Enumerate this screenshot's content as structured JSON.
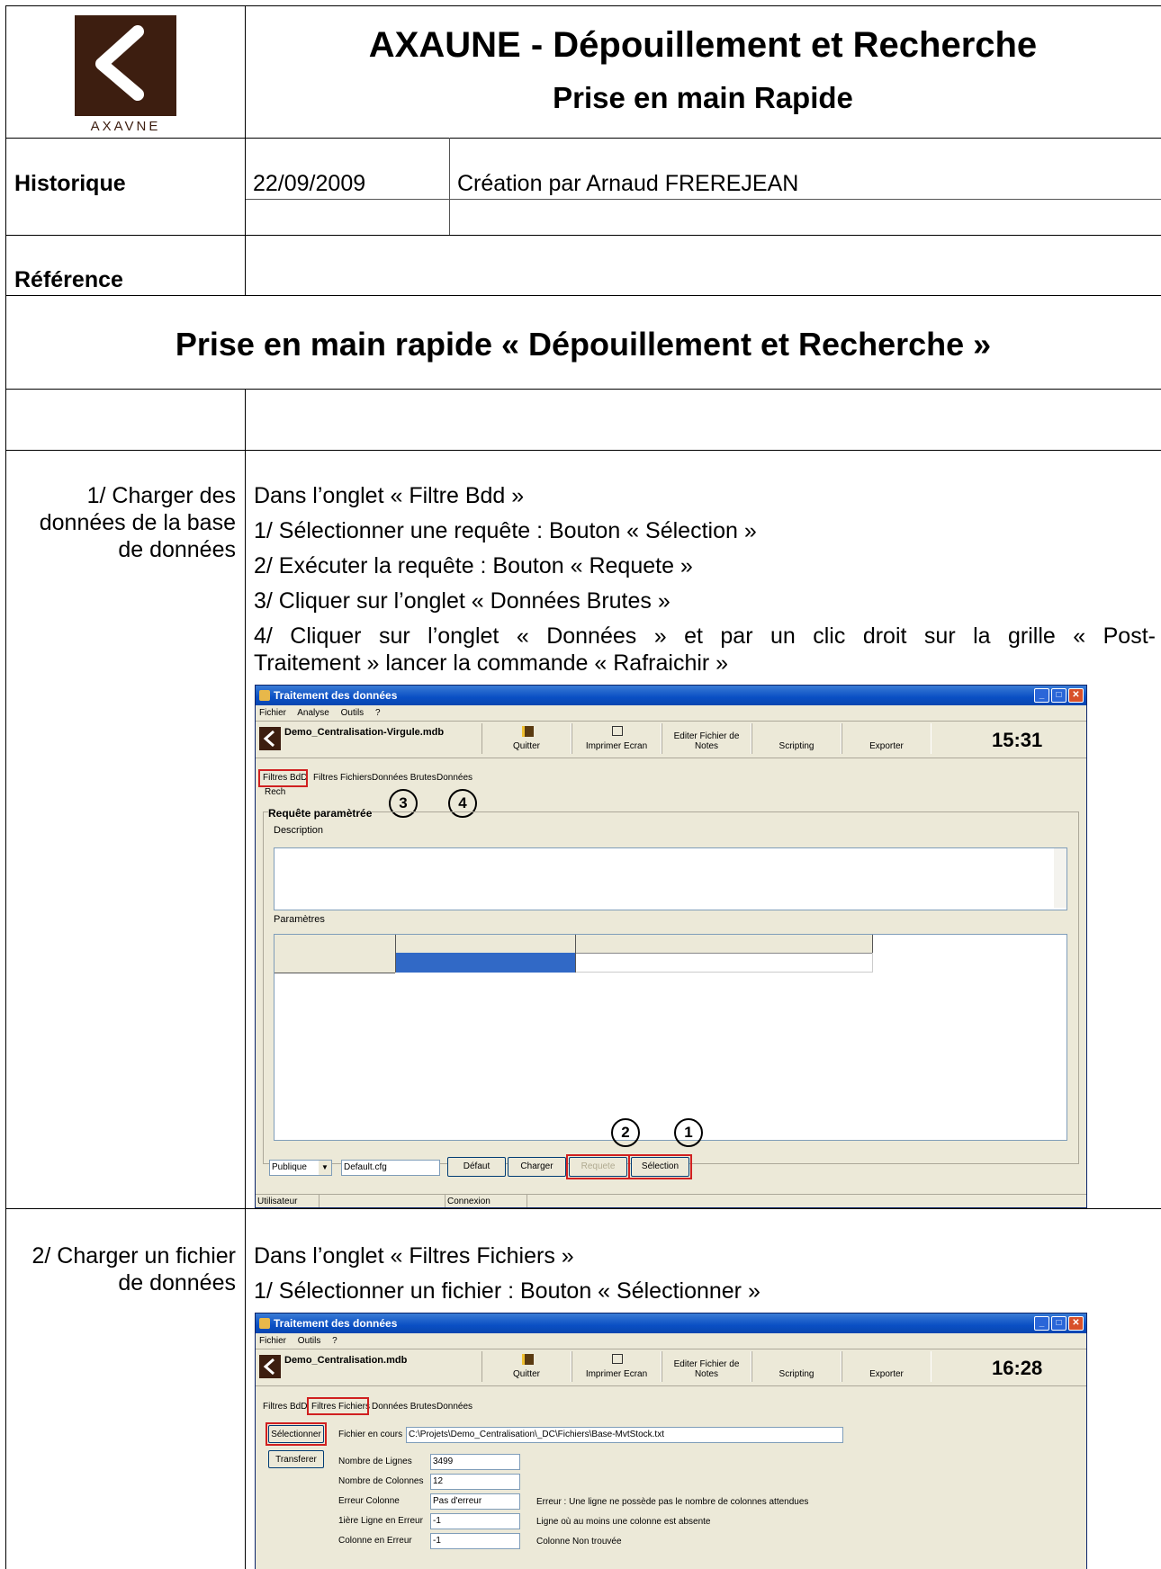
{
  "header": {
    "logo_text": "AXAVNE",
    "title": "AXAUNE - Dépouillement et Recherche",
    "subtitle": "Prise en main Rapide"
  },
  "historique": {
    "label": "Historique",
    "date": "22/09/2009",
    "description": "Création par Arnaud FREREJEAN"
  },
  "reference": {
    "label": "Référence"
  },
  "section_title": "Prise en main rapide « Dépouillement et Recherche »",
  "step1": {
    "label_lines": [
      "1/ Charger des",
      "données de la base",
      "de données"
    ],
    "lines": [
      "Dans l’onglet « Filtre Bdd »",
      "1/ Sélectionner une requête : Bouton « Sélection »",
      "2/ Exécuter la requête : Bouton « Requete »",
      "3/ Cliquer sur l’onglet « Données Brutes »",
      "4/ Cliquer sur l’onglet « Données » et par un clic droit sur la grille « Post-",
      "Traitement » lancer la commande « Rafraichir »"
    ],
    "window": {
      "title": "Traitement des données",
      "menu": [
        "Fichier",
        "Analyse",
        "Outils",
        "?"
      ],
      "db_name": "Demo_Centralisation-Virgule.mdb",
      "toolbar": [
        "Quitter",
        "Imprimer Ecran",
        "Editer Fichier de Notes",
        "Scripting",
        "Exporter"
      ],
      "clock": "15:31",
      "tabs": [
        "Filtres BdD",
        "Filtres Fichiers",
        "Données Brutes",
        "Données"
      ],
      "subtab": "Rech",
      "group_title": "Requête paramètrée",
      "description_label": "Description",
      "parametres_label": "Paramètres",
      "scope_select": "Publique",
      "config_field": "Default.cfg",
      "buttons": [
        "Défaut",
        "Charger",
        "Requete",
        "Sélection"
      ],
      "status": [
        "Utilisateur",
        "Connexion"
      ],
      "callouts": [
        "3",
        "4",
        "2",
        "1"
      ]
    }
  },
  "step2": {
    "label_lines": [
      "2/ Charger un fichier",
      "de données"
    ],
    "lines": [
      "Dans l’onglet « Filtres Fichiers »",
      "1/ Sélectionner un fichier : Bouton « Sélectionner »"
    ],
    "window": {
      "title": "Traitement des données",
      "menu": [
        "Fichier",
        "Outils",
        "?"
      ],
      "db_name": "Demo_Centralisation.mdb",
      "toolbar": [
        "Quitter",
        "Imprimer Ecran",
        "Editer Fichier de Notes",
        "Scripting",
        "Exporter"
      ],
      "clock": "16:28",
      "tabs": [
        "Filtres BdD",
        "Filtres Fichiers",
        "Données Brutes",
        "Données"
      ],
      "buttons": [
        "Sélectionner",
        "Transferer"
      ],
      "current_file_label": "Fichier en cours",
      "current_file": "C:\\Projets\\Demo_Centralisation\\_DC\\Fichiers\\Base-MvtStock.txt",
      "fields": [
        {
          "label": "Nombre de Lignes",
          "value": "3499",
          "note": ""
        },
        {
          "label": "Nombre de Colonnes",
          "value": "12",
          "note": ""
        },
        {
          "label": "Erreur Colonne",
          "value": "Pas d'erreur",
          "note": "Erreur : Une ligne ne possède pas le nombre de  colonnes attendues"
        },
        {
          "label": "1ière Ligne en Erreur",
          "value": "-1",
          "note": "Ligne où au moins une colonne est absente"
        },
        {
          "label": "Colonne en Erreur",
          "value": "-1",
          "note": "Colonne Non trouvée"
        }
      ]
    }
  }
}
